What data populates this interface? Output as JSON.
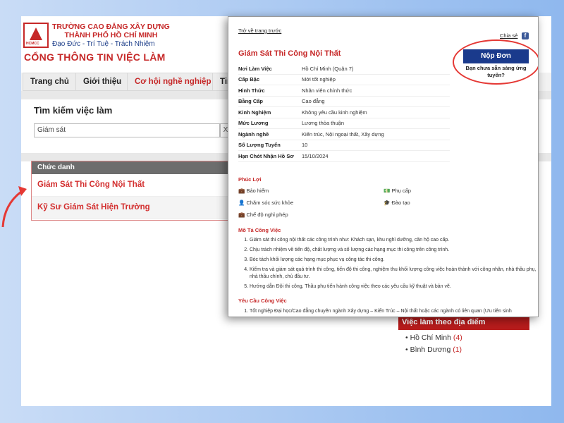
{
  "header": {
    "school_name_line1": "TRƯỜNG CAO ĐẲNG XÂY DỰNG",
    "school_name_line2": "THÀNH PHỐ HỒ CHÍ MINH",
    "motto": "Đạo Đức - Trí Tuệ - Trách Nhiệm",
    "portal_title": "CỔNG THÔNG TIN VIỆC LÀM",
    "logo_text": "HCMCC"
  },
  "nav": {
    "tabs": [
      "Trang chủ",
      "Giới thiệu",
      "Cơ hội nghề nghiệp",
      "Tin"
    ]
  },
  "search": {
    "title": "Tìm kiếm việc làm",
    "value": "Giám sát",
    "clear_label": "X"
  },
  "jobs": {
    "column_header": "Chức danh",
    "rows": [
      "Giám Sát Thi Công Nội Thất",
      "Kỹ Sư Giám Sát Hiện Trường"
    ]
  },
  "locations": {
    "title": "Việc làm theo địa điểm",
    "items": [
      {
        "name": "Hồ Chí Minh",
        "count": "(4)"
      },
      {
        "name": "Bình Dương",
        "count": "(1)"
      }
    ]
  },
  "detail": {
    "back_link": "Trở về trang trước",
    "share_label": "Chia sẻ",
    "title": "Giám Sát Thi Công Nội Thất",
    "apply_label": "Nộp Đơn",
    "ready_text": "Bạn chưa sẵn sàng ứng tuyển?",
    "info": [
      {
        "k": "Nơi Làm Việc",
        "v": "Hồ Chí Minh (Quận 7)"
      },
      {
        "k": "Cấp Bậc",
        "v": "Mới tốt nghiệp"
      },
      {
        "k": "Hình Thức",
        "v": "Nhân viên chính thức"
      },
      {
        "k": "Bằng Cấp",
        "v": "Cao đẳng"
      },
      {
        "k": "Kinh Nghiệm",
        "v": "Không yêu cầu kinh nghiệm"
      },
      {
        "k": "Mức Lương",
        "v": "Lương thỏa thuận"
      },
      {
        "k": "Ngành nghề",
        "v": "Kiến trúc, Nội ngoại thất, Xây dựng"
      },
      {
        "k": "Số Lượng Tuyển",
        "v": "10"
      },
      {
        "k": "Hạn Chót Nhận Hồ Sơ",
        "v": "15/10/2024"
      }
    ],
    "benefits_title": "Phúc Lợi",
    "benefits": [
      "Bảo hiểm",
      "Phụ cấp",
      "Chăm sóc sức khỏe",
      "Đào tạo",
      "Chế độ nghỉ phép"
    ],
    "description_title": "Mô Tả Công Việc",
    "description": [
      "Giám sát thi công nội thất các công trình như: Khách sạn, khu nghỉ dưỡng, căn hộ cao cấp.",
      "Chịu trách nhiệm về tiến độ, chất lượng và số lượng các hạng mục thi công trên công trình.",
      "Bóc tách khối lượng các hạng mục phục vụ công tác thi công.",
      "Kiểm tra và giám sát quá trình thi công, tiến độ thi công, nghiệm thu khối lượng công việc hoàn thành với công nhân, nhà thầu phụ, nhà thầu chính, chủ đầu tư.",
      "Hướng dẫn Đội thi công, Thầu phụ tiến hành công việc theo các yêu cầu kỹ thuật và bản vẽ."
    ],
    "requirements_title": "Yêu Cầu Công Việc",
    "requirements": [
      "Tốt nghiệp Đại học/Cao đẳng chuyên ngành Xây dựng – Kiến Trúc – Nội thất hoặc các ngành có liên quan (Ưu tiên sinh"
    ]
  }
}
